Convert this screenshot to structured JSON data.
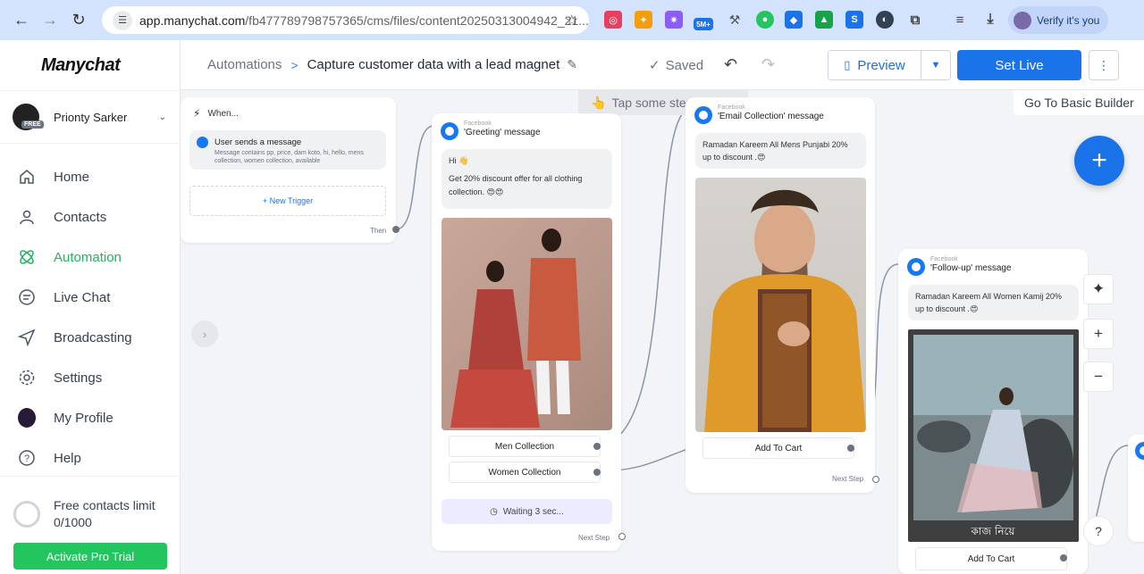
{
  "browser": {
    "url_host": "app.manychat.com",
    "url_path": "/fb477789798757365/cms/files/content20250313004942_21...",
    "verify_label": "Verify it's you",
    "ext_badge": "5M+"
  },
  "sidebar": {
    "logo": "Manychat",
    "account_name": "Prionty Sarker",
    "account_badge": "FREE",
    "items": [
      {
        "label": "Home",
        "icon": "home-icon"
      },
      {
        "label": "Contacts",
        "icon": "person-icon"
      },
      {
        "label": "Automation",
        "icon": "automation-icon"
      },
      {
        "label": "Live Chat",
        "icon": "chat-icon"
      },
      {
        "label": "Broadcasting",
        "icon": "send-icon"
      },
      {
        "label": "Settings",
        "icon": "gear-icon"
      },
      {
        "label": "My Profile",
        "icon": "avatar-icon"
      },
      {
        "label": "Help",
        "icon": "help-icon"
      }
    ],
    "limit_label": "Free contacts limit",
    "limit_value": "0/1000",
    "pro_button": "Activate Pro Trial"
  },
  "header": {
    "breadcrumb_root": "Automations",
    "breadcrumb_current": "Capture customer data with a lead magnet",
    "saved": "Saved",
    "preview": "Preview",
    "set_live": "Set Live"
  },
  "canvas": {
    "hint": "Tap some step to edit",
    "basic_builder": "Go To Basic Builder",
    "trigger": {
      "when": "When...",
      "title": "User sends a message",
      "detail": "Message contains pp, price, dam koto, hi, hello, mens collection, women collection, available",
      "new_trigger": "+ New Trigger",
      "then": "Then"
    },
    "greeting": {
      "platform": "Facebook",
      "title": "'Greeting' message",
      "text_1": "Hi 👋",
      "text_2": "Get 20% discount offer for all clothing collection. 😍😍",
      "button_1": "Men Collection",
      "button_2": "Women Collection",
      "waiting": "Waiting 3 sec...",
      "next": "Next Step"
    },
    "email": {
      "platform": "Facebook",
      "title": "'Email Collection' message",
      "text": "Ramadan Kareem All Mens Punjabi 20% up to discount .😍",
      "button": "Add To Cart",
      "next": "Next Step"
    },
    "followup": {
      "platform": "Facebook",
      "title": "'Follow-up' message",
      "text": "Ramadan Kareem All Women Kamij 20% up to discount .😍",
      "image_caption": "কাজ নিয়ে",
      "button": "Add To Cart"
    }
  }
}
